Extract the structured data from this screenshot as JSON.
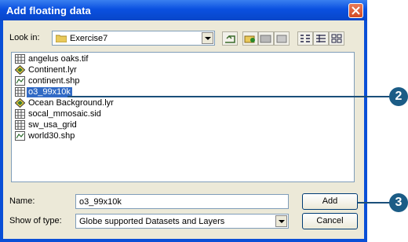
{
  "dialog": {
    "title": "Add floating data",
    "look_in_label": "Look in:",
    "look_in_value": "Exercise7",
    "files": [
      {
        "name": "angelus oaks.tif",
        "icon": "raster-icon",
        "selected": false
      },
      {
        "name": "Continent.lyr",
        "icon": "layer-icon",
        "selected": false
      },
      {
        "name": "continent.shp",
        "icon": "shapefile-icon",
        "selected": false
      },
      {
        "name": "o3_99x10k",
        "icon": "raster-icon",
        "selected": true
      },
      {
        "name": "Ocean Background.lyr",
        "icon": "layer-icon",
        "selected": false
      },
      {
        "name": "socal_mmosaic.sid",
        "icon": "raster-icon",
        "selected": false
      },
      {
        "name": "sw_usa_grid",
        "icon": "raster-icon",
        "selected": false
      },
      {
        "name": "world30.shp",
        "icon": "shapefile-icon",
        "selected": false
      }
    ],
    "name_label": "Name:",
    "name_value": "o3_99x10k",
    "type_label": "Show of type:",
    "type_value": "Globe supported Datasets and Layers",
    "add_label": "Add",
    "cancel_label": "Cancel"
  },
  "callouts": {
    "first": "2",
    "second": "3"
  }
}
